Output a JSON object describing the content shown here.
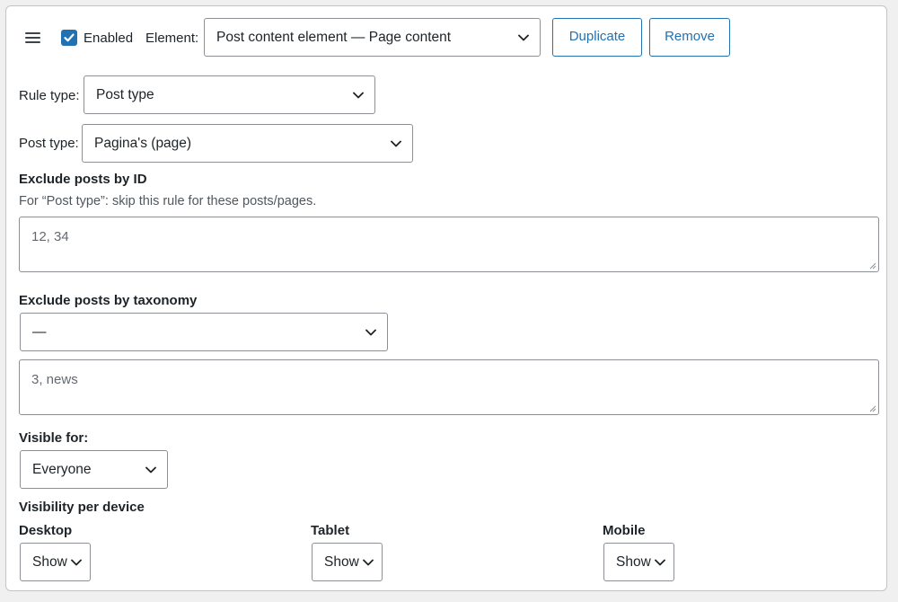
{
  "header": {
    "enabled_label": "Enabled",
    "enabled_checked": true,
    "element_label": "Element:",
    "element_value": "Post content element — Page content",
    "duplicate_label": "Duplicate",
    "remove_label": "Remove"
  },
  "rule_type": {
    "label": "Rule type:",
    "value": "Post type"
  },
  "post_type": {
    "label": "Post type:",
    "value": "Pagina's (page)"
  },
  "exclude_ids": {
    "heading": "Exclude posts by ID",
    "description": "For “Post type”: skip this rule for these posts/pages.",
    "placeholder": "12, 34"
  },
  "exclude_taxonomy": {
    "heading": "Exclude posts by taxonomy",
    "select_value": "—",
    "placeholder": "3, news"
  },
  "visible_for": {
    "label": "Visible for:",
    "value": "Everyone"
  },
  "device_visibility": {
    "heading": "Visibility per device",
    "devices": [
      {
        "label": "Desktop",
        "value": "Show"
      },
      {
        "label": "Tablet",
        "value": "Show"
      },
      {
        "label": "Mobile",
        "value": "Show"
      }
    ]
  },
  "colors": {
    "accent": "#2271b1",
    "border": "#8c8f94",
    "text": "#1d2327",
    "muted": "#50575e"
  },
  "icons": [
    "drag-handle-icon",
    "checkmark-icon",
    "chevron-down-icon",
    "resize-grip-icon"
  ]
}
